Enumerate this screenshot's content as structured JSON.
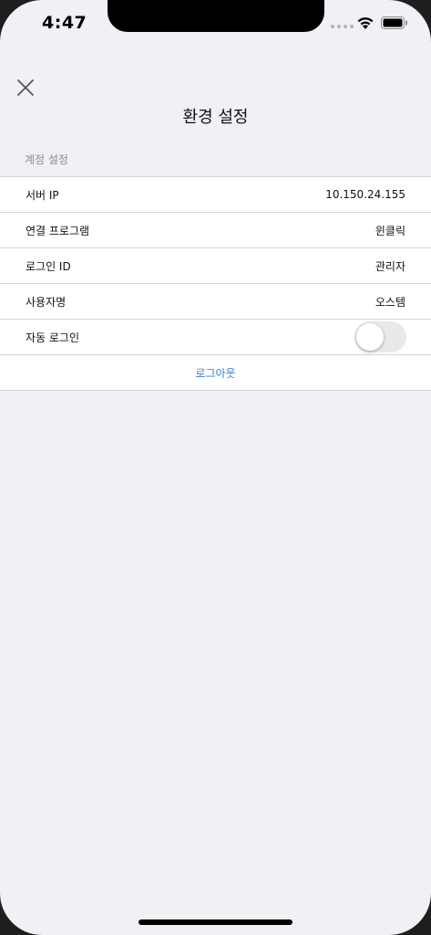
{
  "status_bar": {
    "time": "4:47"
  },
  "header": {
    "title": "환경 설정",
    "close_icon": "close-icon"
  },
  "section": {
    "title": "계정 설정"
  },
  "settings": {
    "rows": [
      {
        "label": "서버 IP",
        "value": "10.150.24.155"
      },
      {
        "label": "연결 프로그램",
        "value": "윈클릭"
      },
      {
        "label": "로그인 ID",
        "value": "관리자"
      },
      {
        "label": "사용자명",
        "value": "오스템"
      }
    ],
    "auto_login": {
      "label": "자동 로그인",
      "enabled": false
    },
    "logout_label": "로그아웃"
  },
  "colors": {
    "background": "#f0f0f5",
    "row_background": "#ffffff",
    "separator": "#d5d5d8",
    "section_text": "#8a8a8e",
    "link": "#3a7fd0",
    "toggle_off": "#e9e9ea"
  }
}
